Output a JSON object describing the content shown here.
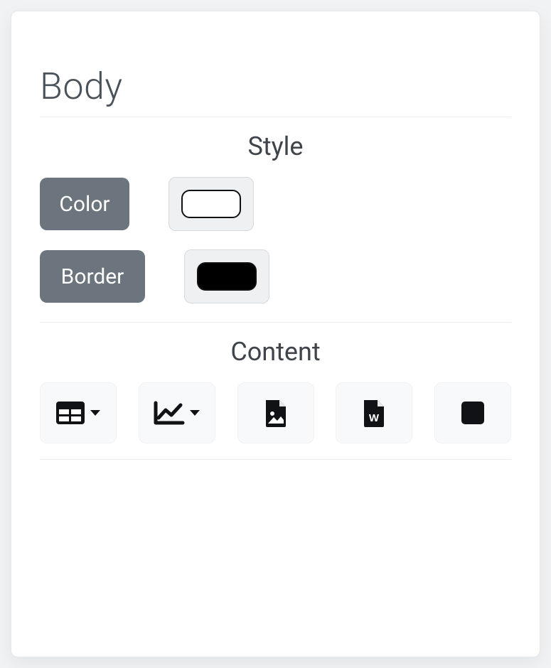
{
  "title": "Body",
  "sections": {
    "style": {
      "heading": "Style",
      "color_label": "Color",
      "border_label": "Border",
      "color_value": "#ffffff",
      "border_value": "#000000"
    },
    "content": {
      "heading": "Content",
      "icons": {
        "table": "table-icon",
        "chart": "chart-line-icon",
        "image": "file-image-icon",
        "word": "file-word-icon",
        "square": "square-icon"
      }
    }
  }
}
